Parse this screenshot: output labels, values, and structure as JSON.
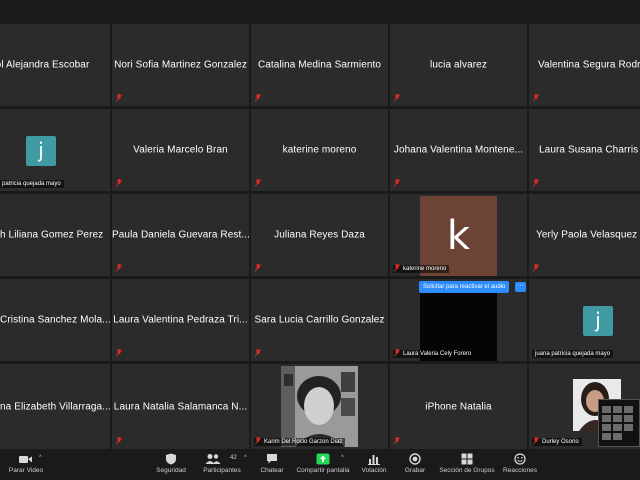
{
  "tiles": [
    {
      "name": "col Alejandra Escobar"
    },
    {
      "name": "Nori Sofia Martinez Gonzalez"
    },
    {
      "name": "Catalina Medina Sarmiento"
    },
    {
      "name": "lucia alvarez"
    },
    {
      "name": "Valentina Segura Rodrig"
    },
    {
      "caption": "patricia quejada mayo",
      "avatar": "j"
    },
    {
      "name": "Valeria Marcelo Bran"
    },
    {
      "name": "katerine moreno"
    },
    {
      "name": "Johana Valentina Montene..."
    },
    {
      "name": "Laura Susana Charris P"
    },
    {
      "name": "h Liliana Gomez Perez"
    },
    {
      "name": "Paula Daniela Guevara Rest..."
    },
    {
      "name": "Juliana Reyes Daza"
    },
    {
      "caption": "katerine moreno",
      "avatar": "k"
    },
    {
      "name": "Yerly Paola Velasquez To"
    },
    {
      "name": "Cristina Sanchez Mola..."
    },
    {
      "name": "Laura Valentina Pedraza Tri..."
    },
    {
      "name": "Sara Lucia Carrillo Gonzalez"
    },
    {
      "caption": "Laura Valeria Cely Forero"
    },
    {
      "caption": "juana patricia quejada mayo",
      "avatar": "j"
    },
    {
      "name": "na Elizabeth Villarraga..."
    },
    {
      "name": "Laura Natalia Salamanca N..."
    },
    {
      "caption": "Karim Del Rocio Garzon Diaz"
    },
    {
      "name": "iPhone Natalia"
    },
    {
      "caption": "Durley Osorio"
    }
  ],
  "tooltip": {
    "text": "Solicitar para reactivar el audio",
    "more": "···"
  },
  "toolbar": {
    "video": "Parar Video",
    "security": "Seguridad",
    "participants": "Participantes",
    "participants_count": "42",
    "chat": "Chatear",
    "share": "Compartir pantalla",
    "vote": "Votación",
    "record": "Grabar",
    "breakout": "Sección de Grupos",
    "reactions": "Reacciones"
  },
  "colors": {
    "tile_bg": "#2b2b2b",
    "avatar_teal": "#3f9aa3",
    "avatar_brown": "#6d4336",
    "share_green": "#23d959",
    "accent_blue": "#2d8cff",
    "muted_red": "#e02828"
  },
  "icons": [
    "mic-muted-icon",
    "video-camera-icon",
    "shield-icon",
    "participants-icon",
    "chat-bubble-icon",
    "share-screen-icon",
    "poll-chart-icon",
    "record-icon",
    "breakout-rooms-icon",
    "reactions-icon",
    "caret-up-icon"
  ]
}
